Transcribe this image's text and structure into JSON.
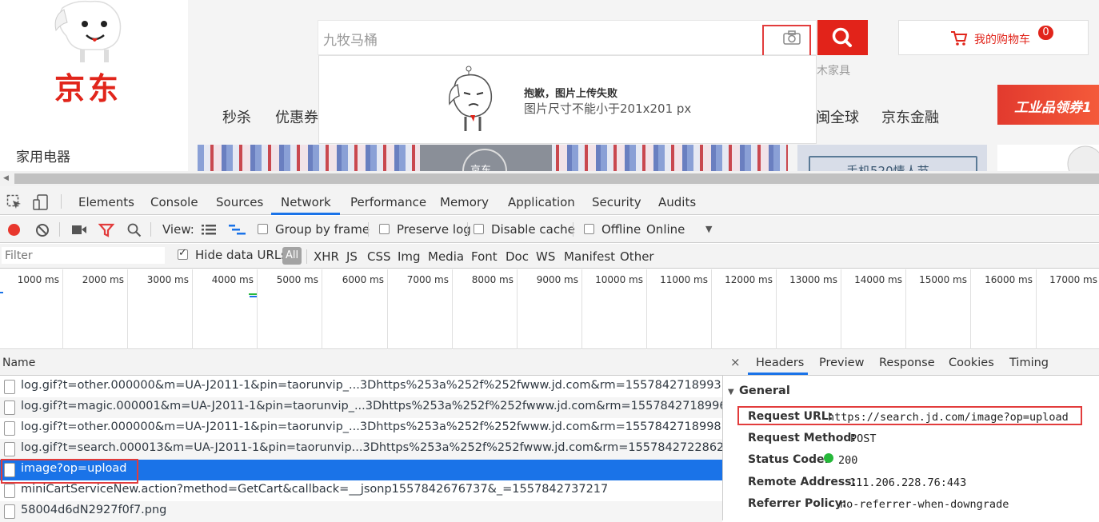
{
  "jd": {
    "logo": "京东",
    "search_placeholder": "九牧马桶",
    "cart_label": "我的购物车",
    "cart_count": "0",
    "hotword_fragment": "木家具",
    "nav": [
      "秒杀",
      "优惠券",
      "闽全球",
      "京东金融"
    ],
    "category_first": "家用电器",
    "upload_error_title": "抱歉，图片上传失败",
    "upload_error_message": "图片尺寸不能小于201x201 px",
    "promo_right": "工业品领券1",
    "banner_badge": "京东",
    "side_banner_text": "手机520情人节",
    "colors": {
      "brand": "#e1251b",
      "search_button": "#e2231a",
      "highlight_box": "#e23c3c"
    }
  },
  "devtools": {
    "tabs": [
      "Elements",
      "Console",
      "Sources",
      "Network",
      "Performance",
      "Memory",
      "Application",
      "Security",
      "Audits"
    ],
    "active_tab": "Network",
    "toolbar": {
      "view_label": "View:",
      "group_by_frame": "Group by frame",
      "preserve_log": "Preserve log",
      "disable_cache": "Disable cache",
      "offline": "Offline",
      "throttle": "Online"
    },
    "filter": {
      "placeholder": "Filter",
      "hide_data_urls": "Hide data URLs",
      "types": [
        "All",
        "XHR",
        "JS",
        "CSS",
        "Img",
        "Media",
        "Font",
        "Doc",
        "WS",
        "Manifest",
        "Other"
      ]
    },
    "timeline_ticks": [
      "1000 ms",
      "2000 ms",
      "3000 ms",
      "4000 ms",
      "5000 ms",
      "6000 ms",
      "7000 ms",
      "8000 ms",
      "9000 ms",
      "10000 ms",
      "11000 ms",
      "12000 ms",
      "13000 ms",
      "14000 ms",
      "15000 ms",
      "16000 ms",
      "17000 ms"
    ],
    "list_header": "Name",
    "requests": [
      "log.gif?t=other.000000&m=UA-J2011-1&pin=taorunvip_...3Dhttps%253a%252f%252fwww.jd.com&rm=1557842718993",
      "log.gif?t=magic.000001&m=UA-J2011-1&pin=taorunvip_...3Dhttps%253a%252f%252fwww.jd.com&rm=1557842718996",
      "log.gif?t=other.000000&m=UA-J2011-1&pin=taorunvip_...3Dhttps%253a%252f%252fwww.jd.com&rm=1557842718998",
      "log.gif?t=search.000013&m=UA-J2011-1&pin=taorunvip...3Dhttps%253a%252f%252fwww.jd.com&rm=1557842722862",
      "image?op=upload",
      "miniCartServiceNew.action?method=GetCart&callback=__jsonp1557842676737&_=1557842737217",
      "58004d6dN2927f0f7.png"
    ],
    "selected_request_index": 4,
    "details_tabs": [
      "×",
      "Headers",
      "Preview",
      "Response",
      "Cookies",
      "Timing"
    ],
    "general": {
      "title": "General",
      "request_url_label": "Request URL:",
      "request_url": "https://search.jd.com/image?op=upload",
      "request_method_label": "Request Method:",
      "request_method": "POST",
      "status_code_label": "Status Code:",
      "status_code": "200",
      "remote_address_label": "Remote Address:",
      "remote_address": "111.206.228.76:443",
      "referrer_policy_label": "Referrer Policy:",
      "referrer_policy": "no-referrer-when-downgrade"
    }
  }
}
